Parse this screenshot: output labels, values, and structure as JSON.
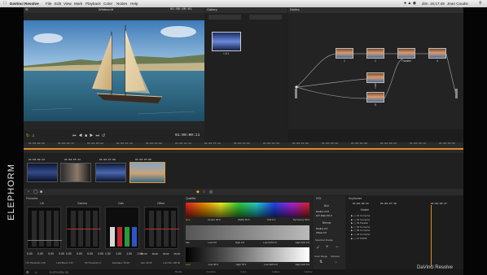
{
  "menubar": {
    "apple": "",
    "app_name": "DaVinci Resolve",
    "items": [
      "File",
      "Edit",
      "View",
      "Mark",
      "Playback",
      "Color",
      "Nodes",
      "Help"
    ],
    "clock": "dim. 15:17:49",
    "user": "Jean Coudsi"
  },
  "viewer": {
    "title": "Whitecroft",
    "timecode": "01:00:40:01",
    "current_tc": "01:00:00:11"
  },
  "gallery": {
    "title": "Gallery",
    "still_label": "1.8.1"
  },
  "nodes": {
    "title": "Nodes",
    "items": [
      {
        "label": "1"
      },
      {
        "label": "2"
      },
      {
        "label": "Parallel"
      },
      {
        "label": "4"
      },
      {
        "label": "3"
      },
      {
        "label": "5"
      }
    ]
  },
  "timeline": {
    "ruler": [
      "01:00:00:00",
      "01:00:02:14",
      "01:00:05:04",
      "01:00:07:18",
      "01:00:10:08",
      "01:00:12:23",
      "01:00:15:12",
      "01:00:18:01",
      "01:00:20:16",
      "01:00:23:06",
      "01:00:25:20",
      "01:00:28:09",
      "01:00:30:23",
      "01:00:33:13",
      "01:00:36:02"
    ],
    "clips": [
      {
        "tc": "01:00:00:13",
        "num": "01"
      },
      {
        "tc": "01:00:25:13",
        "num": "02"
      },
      {
        "tc": "01:00:27:09",
        "num": "03"
      },
      {
        "tc": "01:00:35:05",
        "num": "04"
      }
    ]
  },
  "primaries": {
    "title": "Primaries",
    "wheels": [
      {
        "label": "Lift",
        "values": [
          "0.00",
          "0.00",
          "0.00",
          "0.00"
        ]
      },
      {
        "label": "Gamma",
        "values": [
          "0.00",
          "0.00",
          "0.00",
          "0.00"
        ]
      },
      {
        "label": "Gain",
        "values": [
          "1.00",
          "1.00",
          "1.00",
          "1.00"
        ]
      },
      {
        "label": "Offset",
        "values": [
          "25.00",
          "25.00",
          "25.00",
          "25.00"
        ]
      }
    ],
    "footer": [
      "Y/S Threshold: 0.25",
      "Hi/S Blend: 0.25",
      "YB Threshold: 0",
      "Saturation: 50.00",
      "Hue: 50.00",
      "Lum Mix: 100.00"
    ]
  },
  "qualifier": {
    "title": "Qualifier",
    "hue": {
      "label": "Hue",
      "center": "Center  30.9",
      "width": "Width  35.6",
      "soft": "Soft  0.1",
      "sym": "Symmetry  50.0"
    },
    "sat": {
      "label": "Sat",
      "low": "Low  0.0",
      "high": "High  0.0",
      "lowsoft": "Low Soft  0.0",
      "highsoft": "High Soft  0.0"
    },
    "lum": {
      "label": "Lum",
      "low": "Low  40.0",
      "high": "High  78.1",
      "lowsoft": "Low Soft  0.0",
      "highsoft": "High Soft  0.0"
    }
  },
  "hsl": {
    "title": "HSL",
    "blur_title": "Blur",
    "radius": "Radius  10.0",
    "hv_ratio": "H/V Ratio  50.0",
    "blend_title": "Blends",
    "blend_radius": "Radius  0.0",
    "blend_offset": "Offset  0.0",
    "selection_range": "Selection Range",
    "invert": "Invert Range",
    "softness": "Softness"
  },
  "keyframes": {
    "title": "Keyframes",
    "tc1": "01:00:00:11",
    "tc2": "01:00:07:10",
    "tc3": "01:00:03:17",
    "master": "Master",
    "rows": [
      "01 Corrector",
      "02 Corrector",
      "03 Parallel",
      "04 Corrector",
      "05 Corrector",
      "06 Corrector",
      "07 PODR"
    ]
  },
  "pages": {
    "items": [
      "Media",
      "Conform",
      "Color",
      "Gallery",
      "Deliver"
    ]
  },
  "footer": {
    "brand": "ELEPHORM  3/5",
    "product": "DaVinci Resolve",
    "watermark": "ELEPHORM"
  }
}
